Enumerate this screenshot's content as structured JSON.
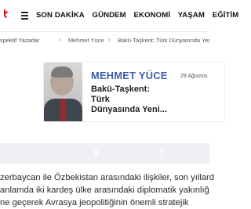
{
  "header": {
    "logo_icon": "news-logo-mark",
    "logo_color": "#d71920",
    "menu_icon": "hamburger-menu-icon",
    "nav": [
      {
        "label": "SON DAKİKA"
      },
      {
        "label": "GÜNDEM"
      },
      {
        "label": "EKONOMİ"
      },
      {
        "label": "YAŞAM"
      },
      {
        "label": "EĞİTİM"
      }
    ]
  },
  "breadcrumb": [
    "spektif Yazarlar",
    "Mehmet Yüce",
    "Bakü-Taşkent: Türk Dünyasında Yeni Strat"
  ],
  "article_card": {
    "author": "MEHMET YÜCE",
    "date": "29 Ağustos",
    "title_line1": "Bakü-Taşkent: Türk",
    "title_line2": "Dünyasında Yeni...",
    "author_color": "#3c5ea8"
  },
  "share_bar": {
    "background": "#eef0f3",
    "icons": [
      "x-icon",
      "facebook-icon"
    ],
    "glyphs": [
      "X",
      "f"
    ]
  },
  "body_lines": [
    "zerbaycan ile Özbekistan arasındaki ilişkiler, son yıllard",
    "anlamda iki kardeş ülke arasındaki diplomatik yakınlığ",
    "ne geçerek Avrasya jeopolitiğinin önemli stratejik"
  ]
}
